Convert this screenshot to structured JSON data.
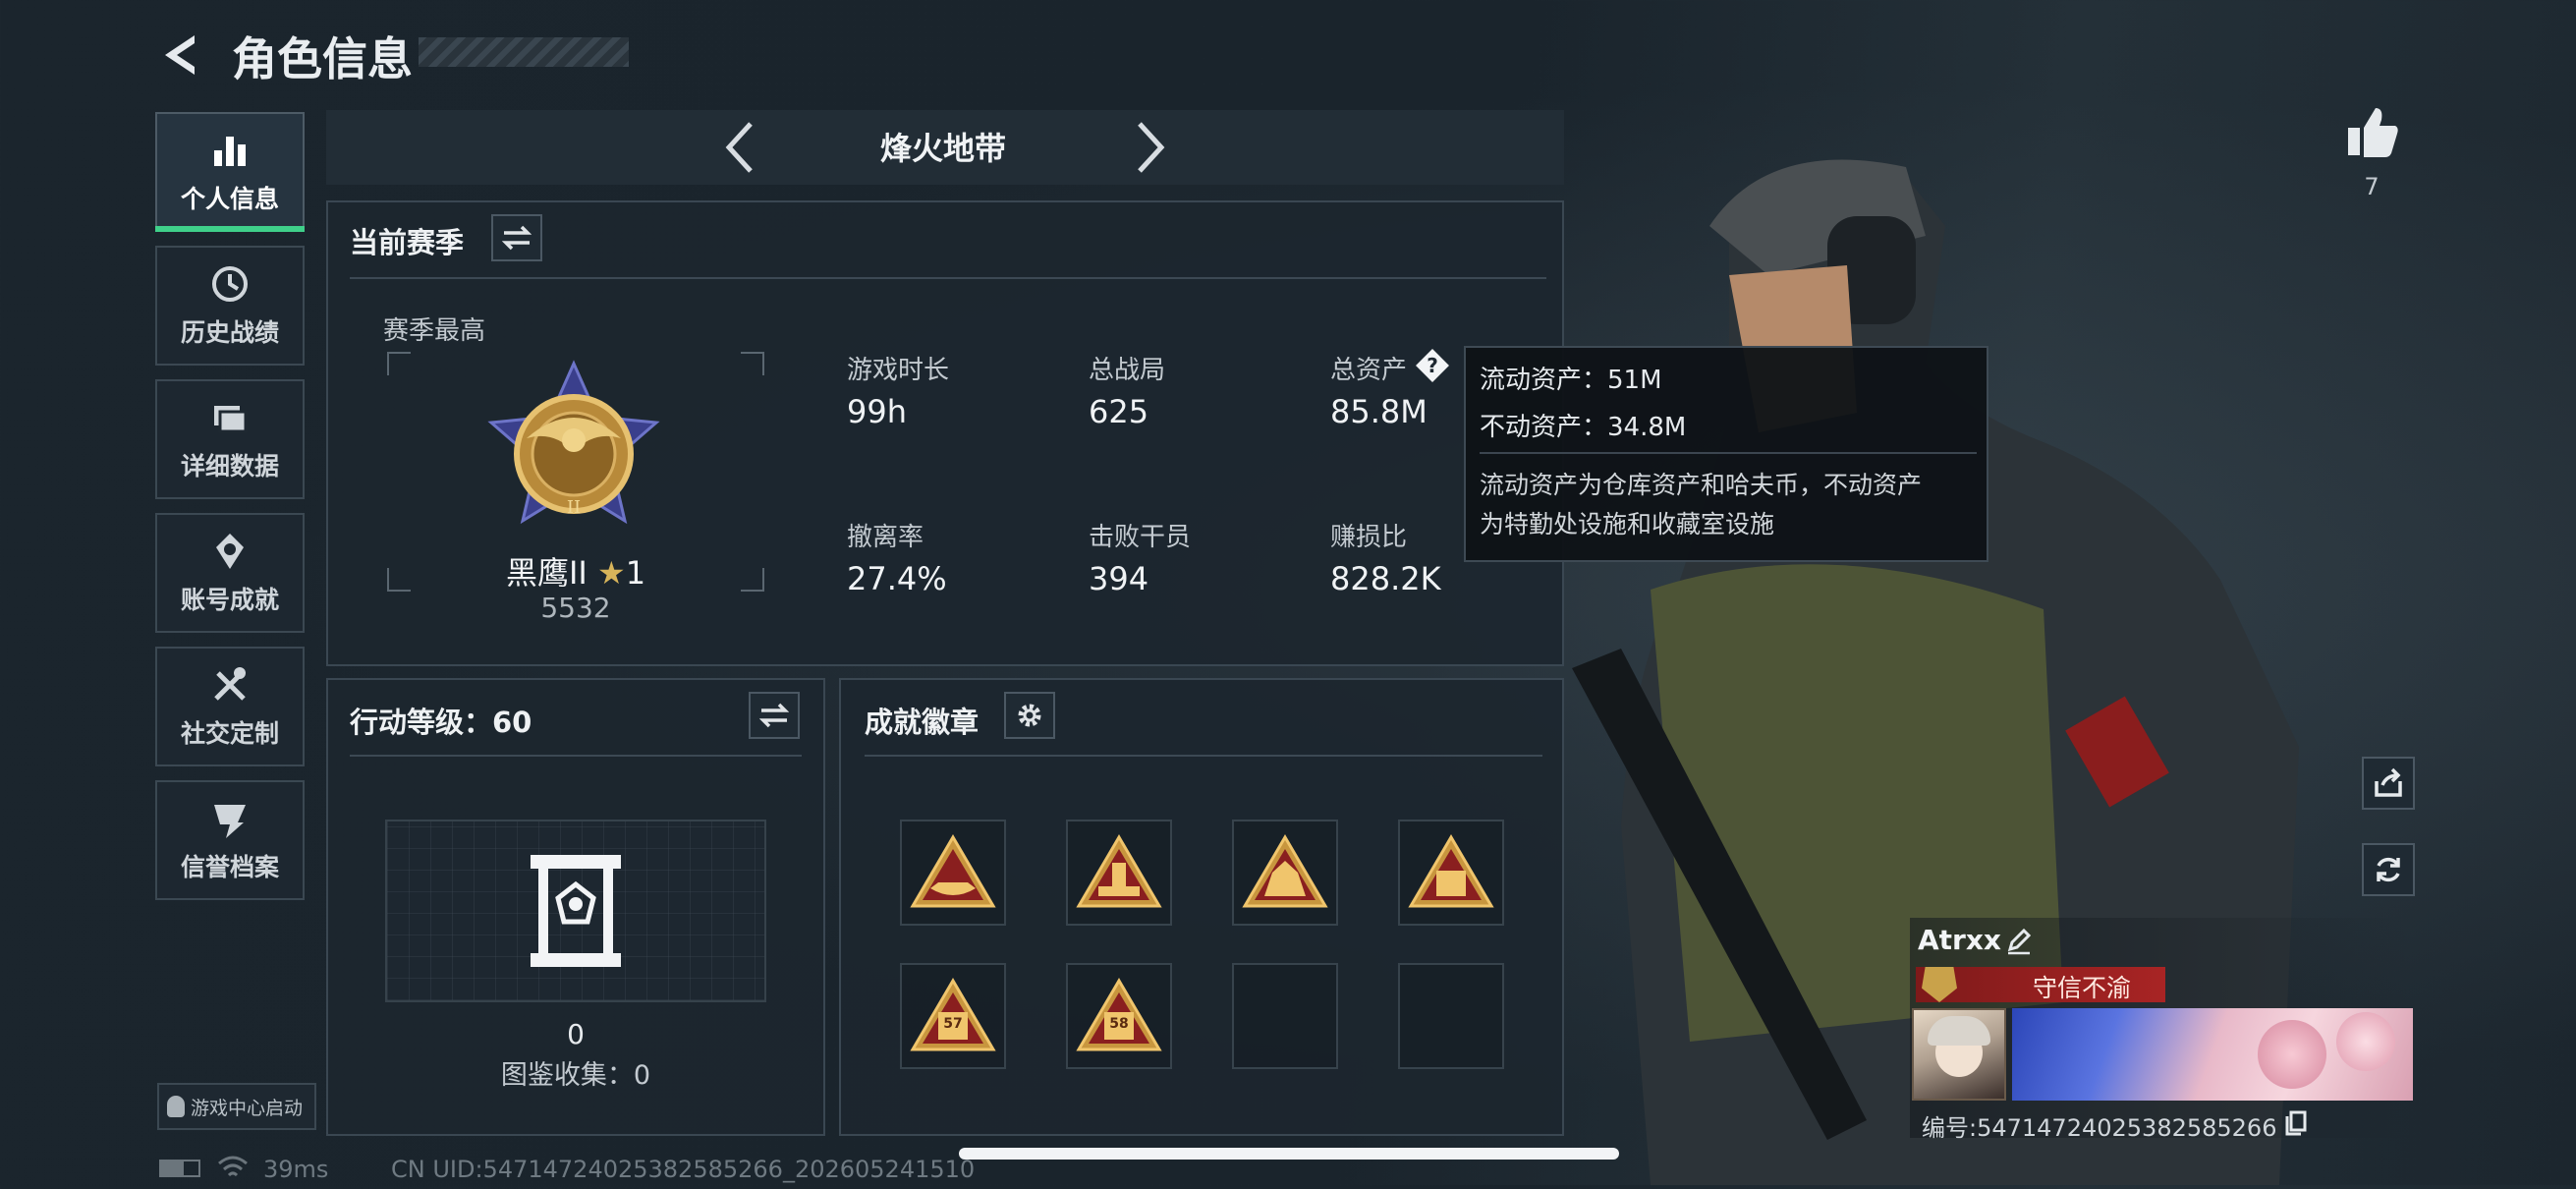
{
  "header": {
    "title": "角色信息"
  },
  "sidebar": {
    "items": [
      {
        "label": "个人信息",
        "icon": "bar-chart-icon"
      },
      {
        "label": "历史战绩",
        "icon": "history-icon"
      },
      {
        "label": "详细数据",
        "icon": "folders-icon"
      },
      {
        "label": "账号成就",
        "icon": "achievement-icon"
      },
      {
        "label": "社交定制",
        "icon": "tools-icon"
      },
      {
        "label": "信誉档案",
        "icon": "reputation-icon"
      }
    ],
    "launch_label": "游戏中心启动"
  },
  "mode_selector": {
    "label": "烽火地带"
  },
  "season": {
    "title": "当前赛季",
    "best_label": "赛季最高",
    "rank_name": "黑鹰II",
    "rank_stars": "1",
    "rank_points": "5532",
    "stats": [
      {
        "label": "游戏时长",
        "value": "99h"
      },
      {
        "label": "总战局",
        "value": "625"
      },
      {
        "label": "总资产",
        "value": "85.8M"
      },
      {
        "label": "撤离率",
        "value": "27.4%"
      },
      {
        "label": "击败干员",
        "value": "394"
      },
      {
        "label": "赚损比",
        "value": "828.2K"
      }
    ]
  },
  "tooltip": {
    "liquid": "流动资产：51M",
    "fixed": "不动资产：34.8M",
    "desc_line1": "流动资产为仓库资产和哈夫币，不动资产",
    "desc_line2": "为特勤处设施和收藏室设施"
  },
  "action_level": {
    "title": "行动等级：60",
    "count": "0",
    "collection": "图鉴收集：0"
  },
  "badges": {
    "title": "成就徽章",
    "items": [
      "57",
      "58"
    ]
  },
  "like": {
    "count": "7"
  },
  "player": {
    "name": "Atrxx",
    "title_tag": "守信不渝",
    "uid_label": "编号:54714724025382585266"
  },
  "status_bar": {
    "ping": "39ms",
    "cn_uid": "CN UID:54714724025382585266_202605241510"
  },
  "colors": {
    "accent_green": "#3fd08a",
    "tag_red": "#8a1d1d",
    "gold": "#c9a24a"
  }
}
